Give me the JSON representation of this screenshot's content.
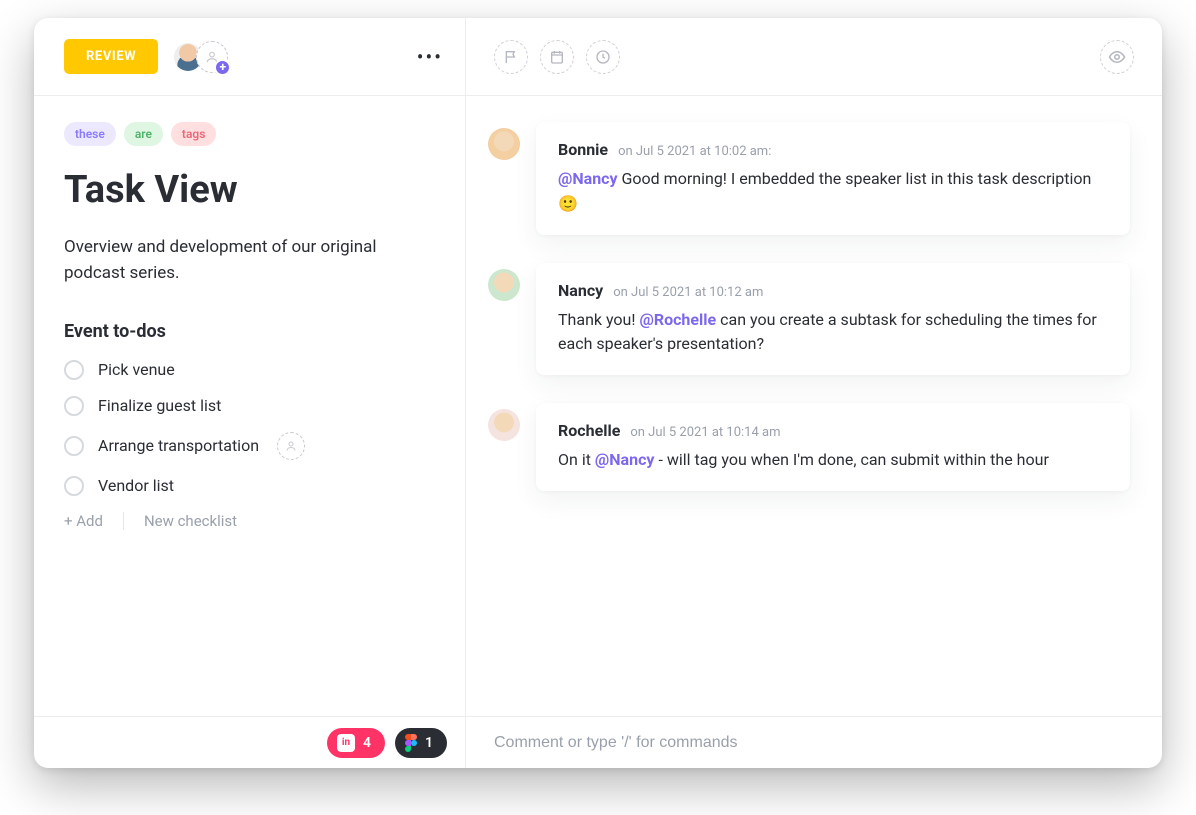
{
  "left": {
    "status": "REVIEW",
    "tags": [
      "these",
      "are",
      "tags"
    ],
    "title": "Task View",
    "description": "Overview and development of our original podcast series.",
    "checklist_title": "Event to-dos",
    "items": [
      {
        "label": "Pick venue",
        "assignee_slot": false
      },
      {
        "label": "Finalize guest list",
        "assignee_slot": false
      },
      {
        "label": "Arrange transportation",
        "assignee_slot": true
      },
      {
        "label": "Vendor list",
        "assignee_slot": false
      }
    ],
    "add_label": "+ Add",
    "new_checklist_label": "New checklist",
    "chips": {
      "invision": {
        "icon_text": "in",
        "count": "4"
      },
      "figma": {
        "count": "1"
      }
    }
  },
  "right": {
    "comments": [
      {
        "author": "Bonnie",
        "meta": "on Jul 5 2021 at 10:02 am:",
        "parts": [
          {
            "type": "mention",
            "text": "@Nancy"
          },
          {
            "type": "text",
            "text": " Good morning! I embedded the speaker list in this task description "
          },
          {
            "type": "emoji",
            "text": "🙂"
          }
        ]
      },
      {
        "author": "Nancy",
        "meta": "on Jul 5 2021 at 10:12 am",
        "parts": [
          {
            "type": "text",
            "text": "Thank you! "
          },
          {
            "type": "mention",
            "text": "@Rochelle"
          },
          {
            "type": "text",
            "text": " can you create a subtask for scheduling the times for each speaker's presentation?"
          }
        ]
      },
      {
        "author": "Rochelle",
        "meta": "on Jul 5 2021 at 10:14 am",
        "parts": [
          {
            "type": "text",
            "text": "On it "
          },
          {
            "type": "mention",
            "text": "@Nancy"
          },
          {
            "type": "text",
            "text": " - will tag you when I'm done, can submit within the hour"
          }
        ]
      }
    ],
    "comment_placeholder": "Comment or type '/' for commands"
  }
}
